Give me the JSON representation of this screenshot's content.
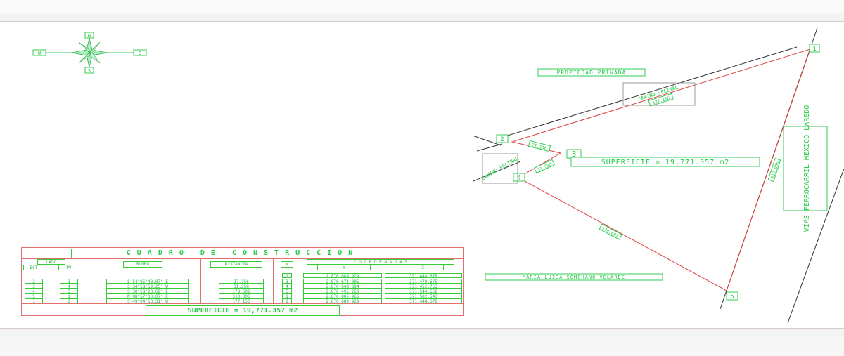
{
  "compass": {
    "north": "N",
    "south": "S",
    "east": "E",
    "west": "W"
  },
  "labels": {
    "propiedad_privada": "PROPIEDAD PRIVADA",
    "camino_vecinal_upper": "CAMINO VECINAL",
    "camino_vecinal_lower": "CAMINO VECINAL",
    "railroad": "VIAS FERROCARRIL MEXICO LAREDO",
    "owner": "MARIA LUISA SOMOHANO VELARDE",
    "superficie": "SUPERFICIE = 19,771.357 m2"
  },
  "vertices": [
    "1",
    "2",
    "3",
    "4",
    "5"
  ],
  "segment_lengths": {
    "s_1_2": "177.156",
    "s_2_3": "27.156",
    "s_3_4": "31.258",
    "s_4_5": "178.601",
    "s_5_1": "313.006"
  },
  "construction_table": {
    "title": "CUADRO DE CONSTRUCCION",
    "headers": {
      "lado": "LADO",
      "est": "EST",
      "pv": "PV",
      "rumbo": "RUMBO",
      "distancia": "DISTANCIA",
      "v": "V",
      "coordenadas": "C O O R D E N A D A S",
      "y": "Y",
      "x": "X"
    },
    "start_row": {
      "v": "2",
      "y": "2,870,689.929",
      "x": "371,448.678"
    },
    "rows": [
      {
        "est": "2",
        "pv": "3",
        "rumbo": "S 54°05'48.07\" E",
        "distancia": "27.156",
        "v": "3",
        "y": "2,870,674.005",
        "x": "371,470.675"
      },
      {
        "est": "3",
        "pv": "4",
        "rumbo": "S 34°58'59.25\" W",
        "distancia": "31.258",
        "v": "4",
        "y": "2,870,648.394",
        "x": "371,452.753"
      },
      {
        "est": "4",
        "pv": "5",
        "rumbo": "S 30°58'23.69\" E",
        "distancia": "178.601",
        "v": "5",
        "y": "2,870,495.260",
        "x": "371,544.668"
      },
      {
        "est": "5",
        "pv": "1",
        "rumbo": "N 08°57'00.07\" E",
        "distancia": "313.006",
        "v": "1",
        "y": "2,870,805.966",
        "x": "371,582.543"
      },
      {
        "est": "1",
        "pv": "2",
        "rumbo": "S 49°04'50.31\" W",
        "distancia": "177.156",
        "v": "2",
        "y": "2,870,689.929",
        "x": "371,448.678"
      }
    ],
    "superficie": "SUPERFICIE = 19,771.357 m2"
  },
  "colors": {
    "drawing_green": "#22cc44",
    "boundary_red": "#e04040",
    "road_line": "#333333",
    "table_border": "#e07070"
  }
}
